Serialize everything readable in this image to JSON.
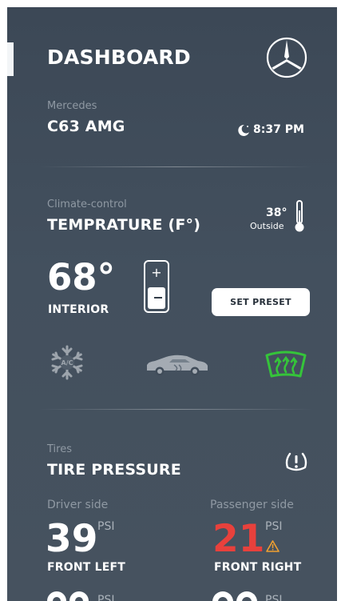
{
  "header": {
    "title": "DASHBOARD",
    "logo_icon": "mercedes-star-icon"
  },
  "car": {
    "make": "Mercedes",
    "model": "C63 AMG",
    "time": "8:37 PM",
    "time_icon": "moon-icon"
  },
  "climate": {
    "label": "Climate-control",
    "title": "TEMPRATURE (F°)",
    "outside_temp": "38°",
    "outside_label": "Outside",
    "interior_temp": "68°",
    "interior_label": "INTERIOR",
    "stepper_plus": "+",
    "preset_button": "SET PRESET",
    "modes": [
      "snowflake-ac-icon",
      "car-icon",
      "windshield-defrost-icon"
    ],
    "active_mode_color": "#35c43a"
  },
  "tires": {
    "label": "Tires",
    "title": "TIRE PRESSURE",
    "warning_icon": "tire-pressure-warning-icon",
    "left": {
      "side": "Driver side",
      "value": "39",
      "unit": "PSI",
      "position": "FRONT LEFT"
    },
    "right": {
      "side": "Passenger side",
      "value": "21",
      "unit": "PSI",
      "position": "FRONT RIGHT",
      "alert_color": "#e8413c"
    },
    "rear_partial_unit": "PSI"
  }
}
